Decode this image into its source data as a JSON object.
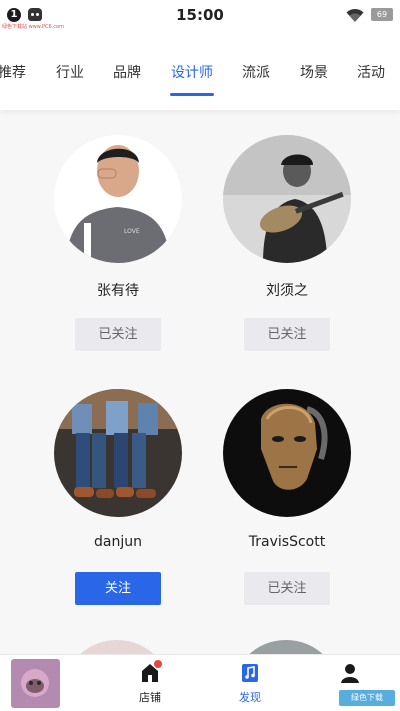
{
  "status_bar": {
    "badge": "1",
    "watermark": "绿色下载站 www.PC6.com",
    "time": "15:00",
    "battery": "69"
  },
  "tabs": [
    {
      "label": "推荐",
      "active": false
    },
    {
      "label": "行业",
      "active": false
    },
    {
      "label": "品牌",
      "active": false
    },
    {
      "label": "设计师",
      "active": true
    },
    {
      "label": "流派",
      "active": false
    },
    {
      "label": "场景",
      "active": false
    },
    {
      "label": "活动",
      "active": false
    }
  ],
  "designers": [
    {
      "name": "张有待",
      "follow_label": "已关注",
      "followed": true
    },
    {
      "name": "刘须之",
      "follow_label": "已关注",
      "followed": true
    },
    {
      "name": "danjun",
      "follow_label": "关注",
      "followed": false
    },
    {
      "name": "TravisScott",
      "follow_label": "已关注",
      "followed": true
    }
  ],
  "bottom_nav": [
    {
      "label": "店铺",
      "icon": "shop-icon",
      "has_badge": true,
      "active": false
    },
    {
      "label": "发现",
      "icon": "discover-icon",
      "has_badge": false,
      "active": true
    },
    {
      "label": "",
      "icon": "user-icon",
      "has_badge": false,
      "active": false
    }
  ],
  "watermark_corner": "绿色下载",
  "colors": {
    "accent": "#2a67e8",
    "followed_bg": "#e9e9ee",
    "badge": "#e84545"
  }
}
